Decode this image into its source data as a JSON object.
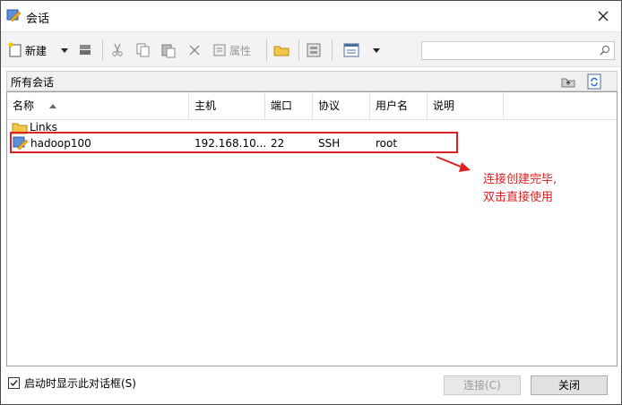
{
  "window": {
    "title": "会话"
  },
  "toolbar": {
    "new_label": "新建",
    "properties_label": "属性"
  },
  "search": {
    "placeholder": ""
  },
  "pathbar": {
    "label": "所有会话"
  },
  "columns": [
    "名称",
    "主机",
    "端口",
    "协议",
    "用户名",
    "说明"
  ],
  "rows": [
    {
      "name": "Links",
      "host": "",
      "port": "",
      "protocol": "",
      "user": "",
      "note": "",
      "icon": "folder-icon"
    },
    {
      "name": "hadoop100",
      "host": "192.168.10...",
      "port": "22",
      "protocol": "SSH",
      "user": "root",
      "note": "",
      "icon": "session-icon"
    }
  ],
  "annotation": {
    "line1": "连接创建完毕,",
    "line2": "双击直接使用",
    "color": "#e02020"
  },
  "footer": {
    "checkbox_label": "启动时显示此对话框(S)",
    "checkbox_checked": true,
    "connect_label": "连接(C)",
    "close_label": "关闭"
  }
}
